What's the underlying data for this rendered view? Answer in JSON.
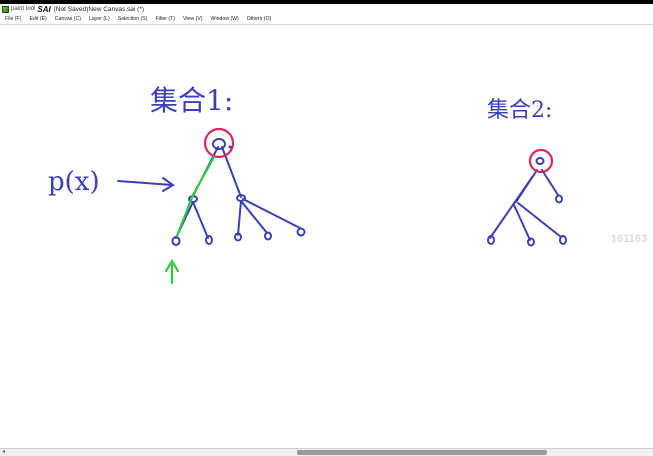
{
  "window": {
    "brand": "paint tool",
    "app_name": "SAI",
    "document_title": "(Not Saved)New Canvas.sai (*)"
  },
  "menu": [
    "File (F)",
    "Edit (E)",
    "Canvas (C)",
    "Layer (L)",
    "Selection (S)",
    "Filter (T)",
    "View (V)",
    "Window (W)",
    "Others (O)"
  ],
  "canvas": {
    "left_label": "集合1:",
    "right_label": "集合2:",
    "left_formula": "p(x)",
    "watermark": "161163"
  },
  "colors": {
    "ink": "#3a3fb8",
    "red": "#e0245e",
    "green": "#2ecc40",
    "titlebar": "#ffffff"
  }
}
